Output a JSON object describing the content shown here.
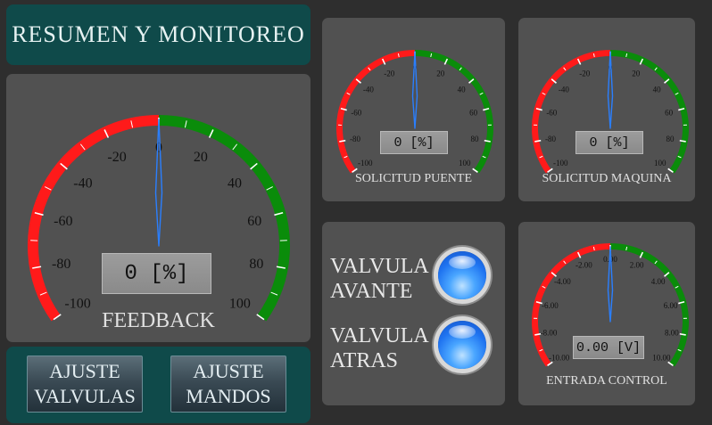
{
  "title": "RESUMEN Y MONITOREO",
  "colors": {
    "negative_arc": "#ff1a1a",
    "positive_arc": "#0a8c0a",
    "needle": "#2a7fff",
    "teal_panel": "#0f4a4a",
    "gray_panel": "#515151",
    "led_blue": "#1f73f0"
  },
  "gauges": {
    "feedback": {
      "label": "FEEDBACK",
      "readout": "0 [%]",
      "value": 0,
      "min": -100,
      "max": 100,
      "ticks": [
        "-100",
        "-80",
        "-60",
        "-40",
        "-20",
        "0",
        "20",
        "40",
        "60",
        "80",
        "100"
      ]
    },
    "puente": {
      "label": "SOLICITUD PUENTE",
      "readout": "0 [%]",
      "value": 0,
      "min": -100,
      "max": 100,
      "ticks": [
        "-100",
        "-80",
        "-60",
        "-40",
        "-20",
        "0",
        "20",
        "40",
        "60",
        "80",
        "100"
      ]
    },
    "maquina": {
      "label": "SOLICITUD MAQUINA",
      "readout": "0 [%]",
      "value": 0,
      "min": -100,
      "max": 100,
      "ticks": [
        "-100",
        "-80",
        "-60",
        "-40",
        "-20",
        "0",
        "20",
        "40",
        "60",
        "80",
        "100"
      ]
    },
    "control": {
      "label": "ENTRADA CONTROL",
      "readout": "0.00 [V]",
      "value": 0,
      "min": -10,
      "max": 10,
      "ticks": [
        "-10.00",
        "-8.00",
        "-6.00",
        "-4.00",
        "-2.00",
        "0.00",
        "2.00",
        "4.00",
        "6.00",
        "8.00",
        "10.00"
      ]
    }
  },
  "valves": {
    "avante": {
      "line1": "VALVULA",
      "line2": "AVANTE"
    },
    "atras": {
      "line1": "VALVULA",
      "line2": "ATRAS"
    }
  },
  "buttons": {
    "ajuste_valvulas": {
      "line1": "AJUSTE",
      "line2": "VALVULAS"
    },
    "ajuste_mandos": {
      "line1": "AJUSTE",
      "line2": "MANDOS"
    }
  }
}
